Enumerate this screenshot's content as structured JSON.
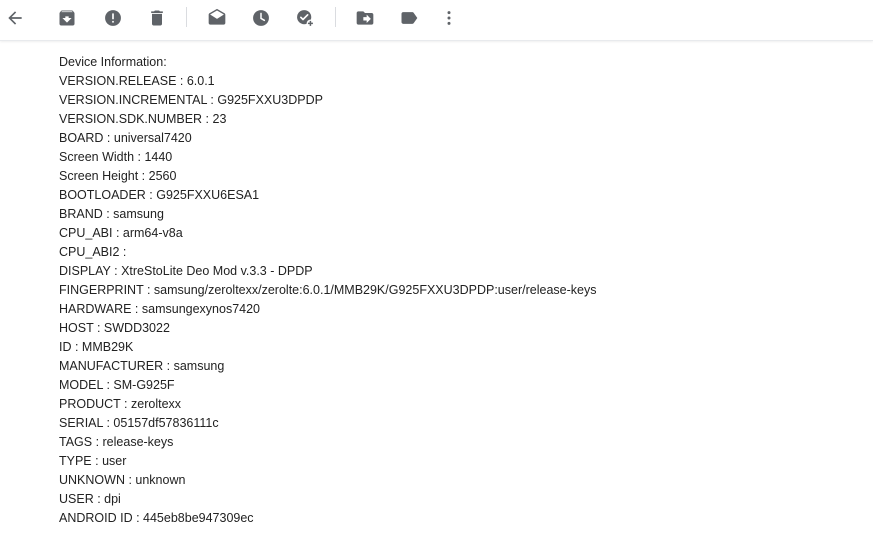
{
  "toolbar": {
    "icons": [
      "back-arrow-icon",
      "archive-icon",
      "report-spam-icon",
      "delete-icon",
      "mark-unread-icon",
      "snooze-icon",
      "add-to-tasks-icon",
      "move-to-icon",
      "label-icon",
      "more-vert-icon"
    ],
    "icon_color": "#5f6368"
  },
  "device_info": {
    "heading": "Device Information:",
    "lines": [
      "VERSION.RELEASE : 6.0.1",
      "VERSION.INCREMENTAL : G925FXXU3DPDP",
      "VERSION.SDK.NUMBER : 23",
      "BOARD : universal7420",
      "Screen Width : 1440",
      "Screen Height : 2560",
      "BOOTLOADER : G925FXXU6ESA1",
      "BRAND : samsung",
      "CPU_ABI : arm64-v8a",
      "CPU_ABI2 : ",
      "DISPLAY : XtreStoLite Deo Mod v.3.3 - DPDP",
      "FINGERPRINT : samsung/zeroltexx/zerolte:6.0.1/MMB29K/G925FXXU3DPDP:user/release-keys",
      "HARDWARE : samsungexynos7420",
      "HOST : SWDD3022",
      "ID : MMB29K",
      "MANUFACTURER : samsung",
      "MODEL : SM-G925F",
      "PRODUCT : zeroltexx",
      "SERIAL : 05157df57836111c",
      "TAGS : release-keys",
      "TYPE : user",
      "UNKNOWN : unknown",
      "USER : dpi",
      "ANDROID ID : 445eb8be947309ec"
    ],
    "text_color": "#222222"
  }
}
